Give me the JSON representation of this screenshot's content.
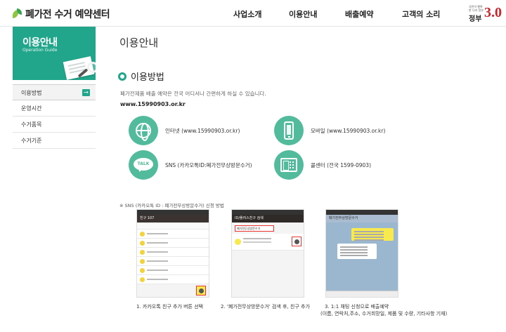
{
  "header": {
    "logo_text": "폐가전 수거 예약센터",
    "nav": [
      {
        "label": "사업소개"
      },
      {
        "label": "이용안내"
      },
      {
        "label": "배출예약"
      },
      {
        "label": "고객의 소리"
      }
    ],
    "gov_small": "국민이 행복한 나라 정부",
    "gov_word": "정부",
    "gov_number": "3.0"
  },
  "sidebar": {
    "banner_title": "이용안내",
    "banner_subtitle": "Operation Guide",
    "items": [
      {
        "label": "이용방법",
        "active": true
      },
      {
        "label": "운영시간"
      },
      {
        "label": "수거품목"
      },
      {
        "label": "수거기준"
      }
    ],
    "arrow": "→"
  },
  "main": {
    "page_title": "이용안내",
    "section_title": "이용방법",
    "description": "폐가전제품 배출 예약은 전국 어디서나 간편하게 하실 수 있습니다.",
    "url": "www.15990903.or.kr",
    "methods": [
      {
        "icon": "globe-icon",
        "label": "인터넷 (www.15990903.or.kr)"
      },
      {
        "icon": "mobile-phone-icon",
        "label": "모바일 (www.15990903.or.kr)"
      },
      {
        "icon": "talk-bubble-icon",
        "icon_text": "TALK",
        "label": "SNS (카카오톡ID:폐가전무상방문수거)"
      },
      {
        "icon": "telephone-icon",
        "label": "콜센터 (전국 1599-0903)"
      }
    ],
    "sns_note": "※ SNS (카카오톡 ID : 폐가전무상방문수거) 신청 방법",
    "screens": {
      "s1_bar": "친구 107",
      "s2_bar": "ID/플러스친구 검색",
      "s2_search": "폐가전무상방문수거",
      "s3_bar": "폐가전무상방문수거"
    },
    "steps": [
      {
        "line1": "1. 카카오톡 친구 추가 버튼 선택",
        "line2": ""
      },
      {
        "line1": "2. '폐가전무상방문수거' 검색 후, 친구 추가",
        "line2": ""
      },
      {
        "line1": "3. 1:1 채팅 신청으로 배출예약",
        "line2": "(이름, 연락처,주소, 수거희망일, 제품 및 수량, 기타사항 기재)"
      }
    ]
  },
  "colors": {
    "accent": "#21a68b",
    "icon_circle": "#52bb9b",
    "gov_red": "#c8252c"
  }
}
